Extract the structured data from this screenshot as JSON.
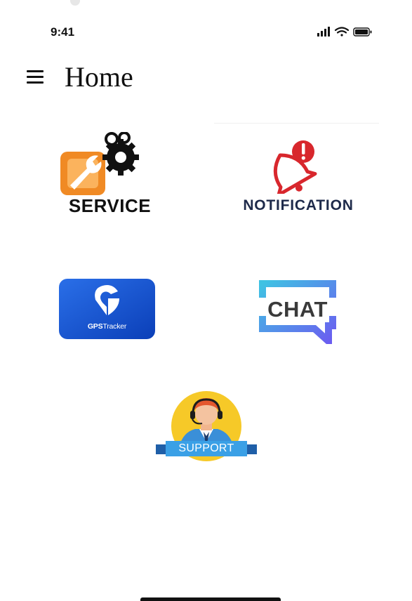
{
  "status_bar": {
    "time": "9:41",
    "icons": [
      "signal-icon",
      "wifi-icon",
      "battery-icon"
    ]
  },
  "header": {
    "menu_icon": "hamburger-menu-icon",
    "title": "Home"
  },
  "tiles": {
    "service": {
      "label": "SERVICE",
      "icon": "gears-wrench-icon",
      "colors": {
        "orange": "#f08a24",
        "gear": "#111111"
      }
    },
    "notification": {
      "label": "NOTIFICATION",
      "icon": "bell-alert-icon",
      "colors": {
        "bell": "#d8272d",
        "text": "#1e2a4a"
      }
    },
    "gps": {
      "label_bold": "GPS",
      "label_rest": "Tracker",
      "icon": "gps-pin-icon",
      "colors": {
        "background": "#1656d6"
      }
    },
    "chat": {
      "label": "CHAT",
      "icon": "chat-bubble-icon",
      "colors": {
        "bubble_start": "#3fc2e3",
        "bubble_end": "#6b5cf0"
      }
    },
    "support": {
      "label": "SUPPORT",
      "icon": "support-agent-icon",
      "colors": {
        "circle": "#f6c928",
        "banner": "#3aa0e6"
      }
    }
  }
}
